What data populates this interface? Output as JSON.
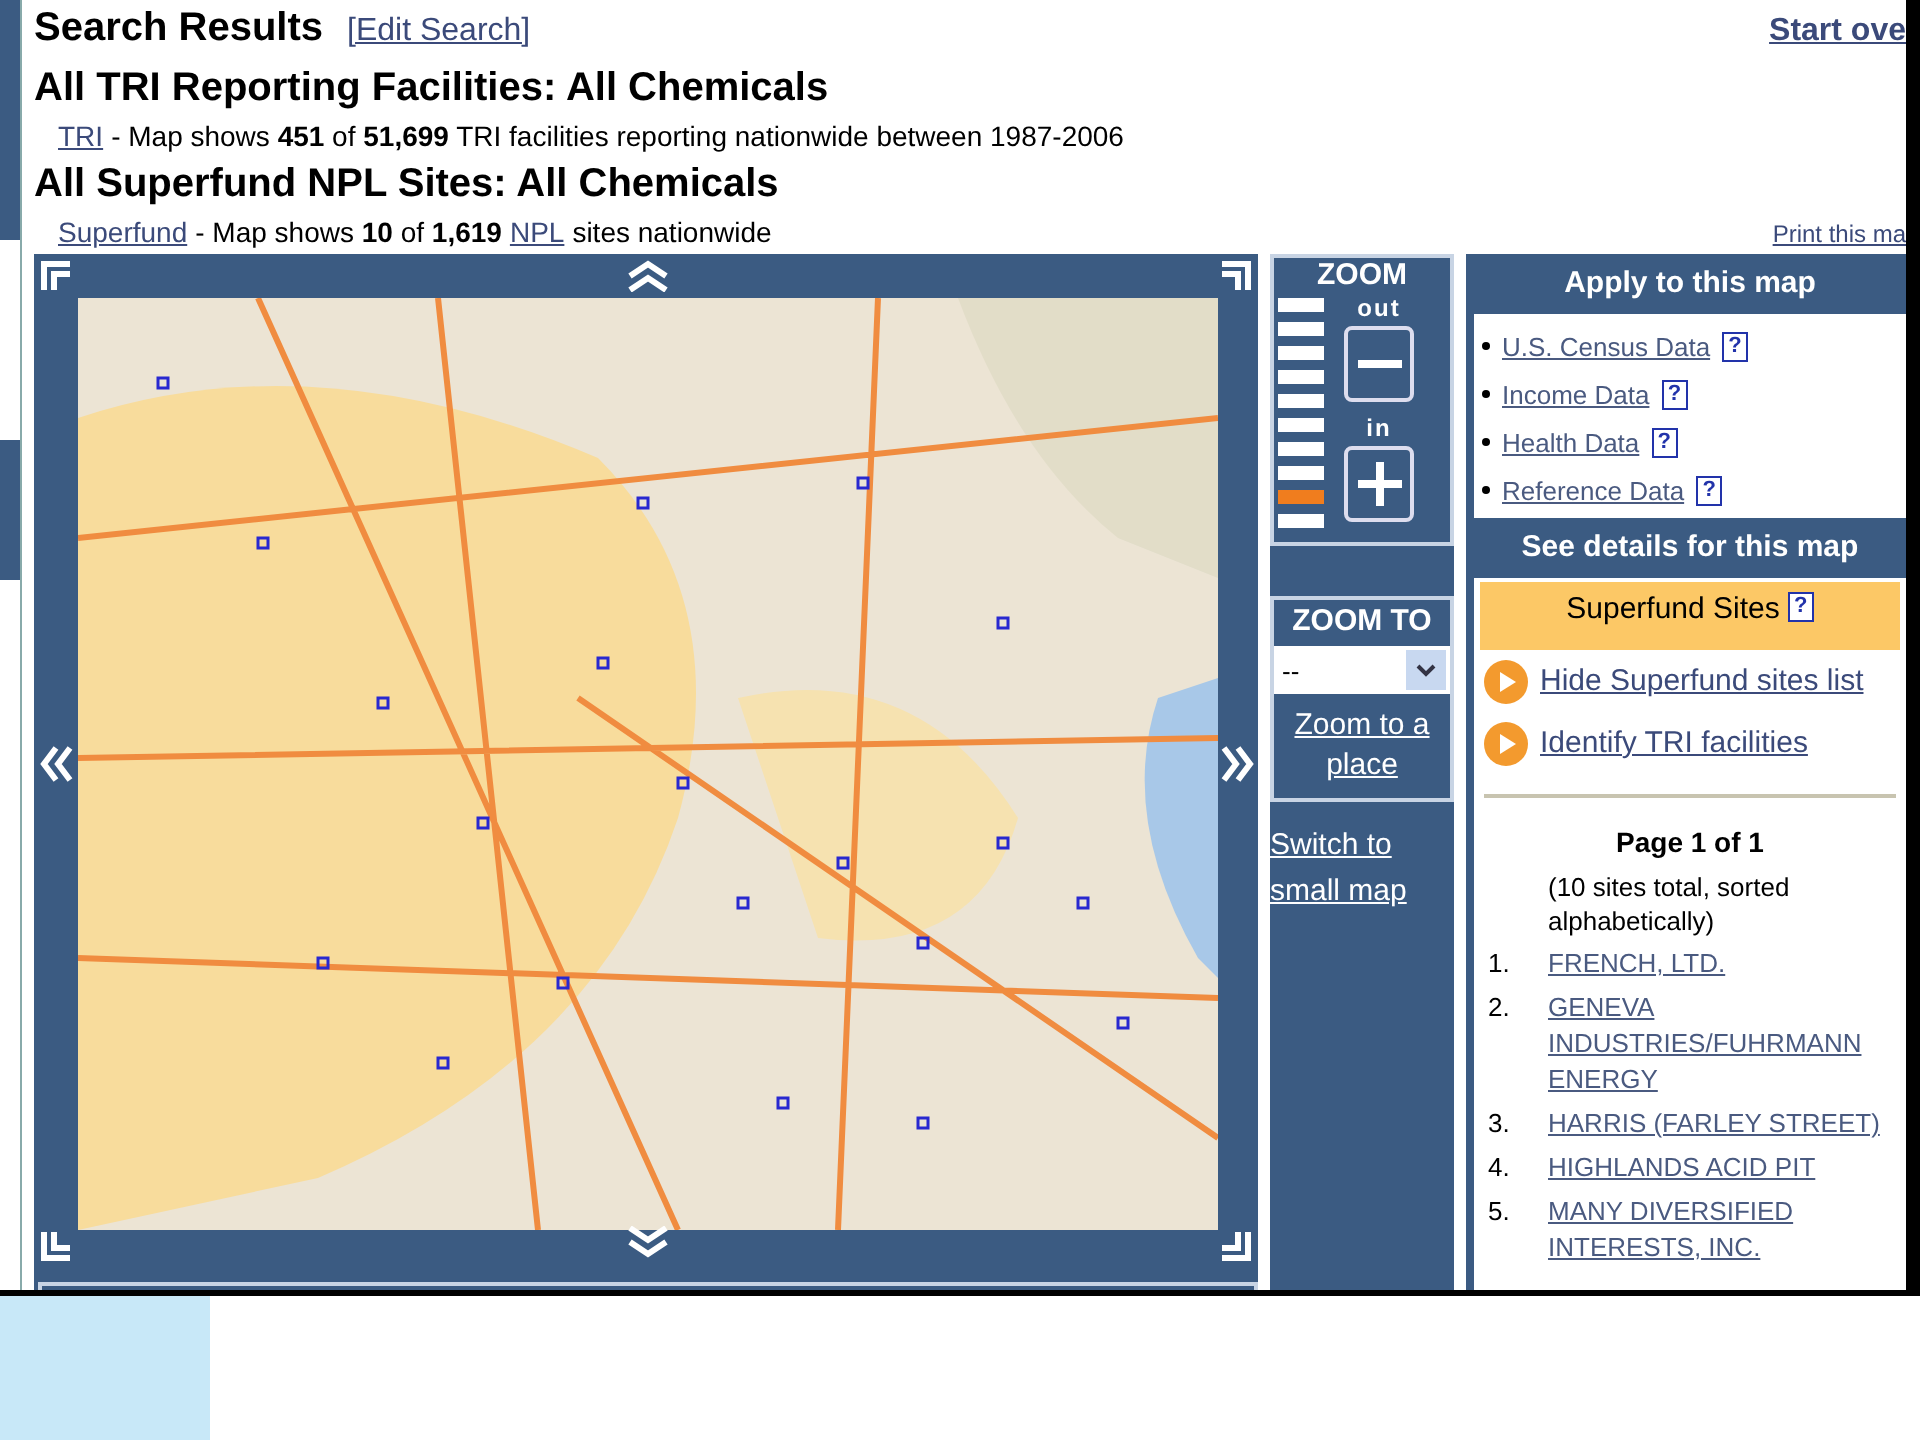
{
  "header": {
    "title": "Search Results",
    "edit_link": "[Edit Search]",
    "start_over": "Start ove"
  },
  "sections": [
    {
      "heading": "All TRI Reporting Facilities: All Chemicals",
      "parts": [
        {
          "kind": "link",
          "text": "TRI"
        },
        {
          "kind": "text",
          "text": "- Map shows **451** of **51,699** TRI facilities reporting nationwide between 1987-2006"
        }
      ]
    },
    {
      "heading": "All Superfund NPL Sites: All Chemicals",
      "parts": [
        {
          "kind": "link",
          "text": "Superfund"
        },
        {
          "kind": "text",
          "text": "- Map shows **10** of **1,619**"
        },
        {
          "kind": "link",
          "text": "NPL"
        },
        {
          "kind": "text",
          "text": "sites nationwide"
        }
      ]
    }
  ],
  "print_link": "Print this ma",
  "zoom": {
    "title": "ZOOM",
    "out_label": "out",
    "in_label": "in",
    "levels": [
      {
        "selected": false
      },
      {
        "selected": false
      },
      {
        "selected": false
      },
      {
        "selected": false
      },
      {
        "selected": false
      },
      {
        "selected": false
      },
      {
        "selected": false
      },
      {
        "selected": false
      },
      {
        "selected": true
      },
      {
        "selected": false
      }
    ]
  },
  "zoom_to": {
    "title": "ZOOM TO",
    "select_value": "--",
    "link": "Zoom to a place"
  },
  "switch_link": "Switch to small map",
  "apply": {
    "title": "Apply to this map",
    "items": [
      {
        "label": "U.S. Census Data",
        "help": "?"
      },
      {
        "label": "Income Data",
        "help": "?"
      },
      {
        "label": "Health Data",
        "help": "?"
      },
      {
        "label": "Reference Data",
        "help": "?"
      }
    ]
  },
  "details": {
    "title": "See details for this map",
    "panel_title": "Superfund Sites",
    "panel_help": "?",
    "actions": [
      "Hide Superfund sites list",
      "Identify TRI facilities"
    ],
    "page": "Page 1 of 1",
    "note": "(10 sites total, sorted alphabetically)",
    "sites": [
      {
        "number": "1.",
        "name": "FRENCH, LTD."
      },
      {
        "number": "2.",
        "name": "GENEVA INDUSTRIES/FUHRMANN ENERGY"
      },
      {
        "number": "3.",
        "name": "HARRIS (FARLEY STREET)"
      },
      {
        "number": "4.",
        "name": "HIGHLANDS ACID PIT"
      },
      {
        "number": "5.",
        "name": "MANY DIVERSIFIED INTERESTS, INC."
      }
    ]
  }
}
